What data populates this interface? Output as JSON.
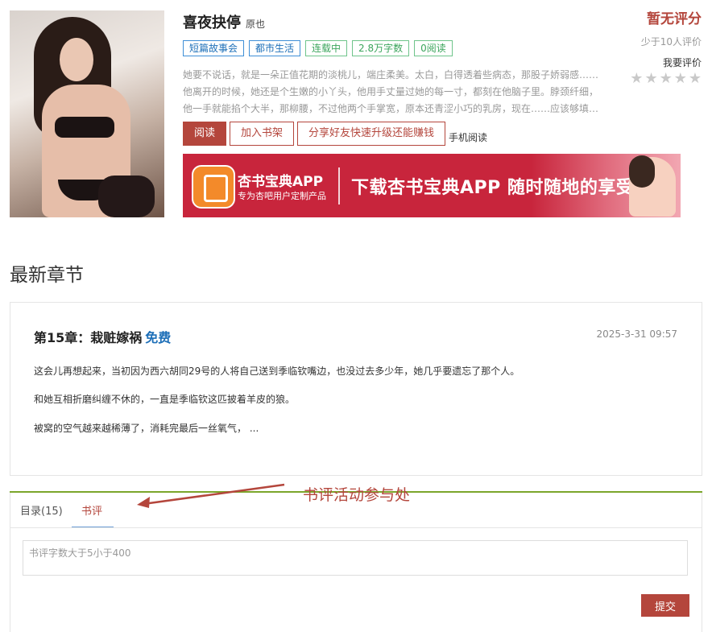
{
  "book": {
    "title": "喜夜抉停",
    "tag": "原也",
    "tags": [
      "短篇故事会",
      "都市生活",
      "连载中",
      "2.8万字数",
      "0阅读"
    ],
    "description": [
      "她要不说话，就是一朵正值花期的淡桃儿，端庄柔美。太白，白得透着些病态，那股子娇弱感……",
      "他离开的时候，她还是个生嫩的小丫头，他用手丈量过她的每一寸，都刻在他脑子里。脖颈纤细，",
      "他一手就能掐个大半，那柳腰，不过他两个手掌宽，原本还青涩小巧的乳房，现在……应该够填…"
    ]
  },
  "actions": {
    "read": "阅读",
    "add_shelf": "加入书架",
    "share": "分享好友快速升级还能赚钱",
    "mobile": "手机阅读"
  },
  "rating": {
    "main": "暂无评分",
    "count": "少于10人评价",
    "rate_link": "我要评价",
    "stars": 0
  },
  "banner": {
    "app_name": "杏书宝典APP",
    "app_sub": "专为杏吧用户定制产品",
    "slogan": "下载杏书宝典APP 随时随地的享受"
  },
  "latest": {
    "section_title": "最新章节",
    "chapter_title": "第15章：栽赃嫁祸",
    "free_label": "免费",
    "date": "2025-3-31 09:57",
    "lines": [
      "这会儿再想起来，当初因为西六胡同29号的人将自己送到季临钦嘴边，也没过去多少年，她几乎要遗忘了那个人。",
      "和她互相折磨纠缠不休的，一直是季临钦这匹披着羊皮的狼。",
      "被窝的空气越来越稀薄了，消耗完最后一丝氧气，  ..."
    ]
  },
  "tabs": {
    "contents": "目录(15)",
    "review": "书评"
  },
  "review": {
    "placeholder": "书评字数大于5小于400",
    "submit": "提交"
  },
  "annotation": "书评活动参与处",
  "colors": {
    "accent": "#b4463c",
    "link": "#1d6fb8",
    "tag_green": "#3ba55c",
    "banner": "#c8253c",
    "divider_green": "#7ba62b"
  }
}
